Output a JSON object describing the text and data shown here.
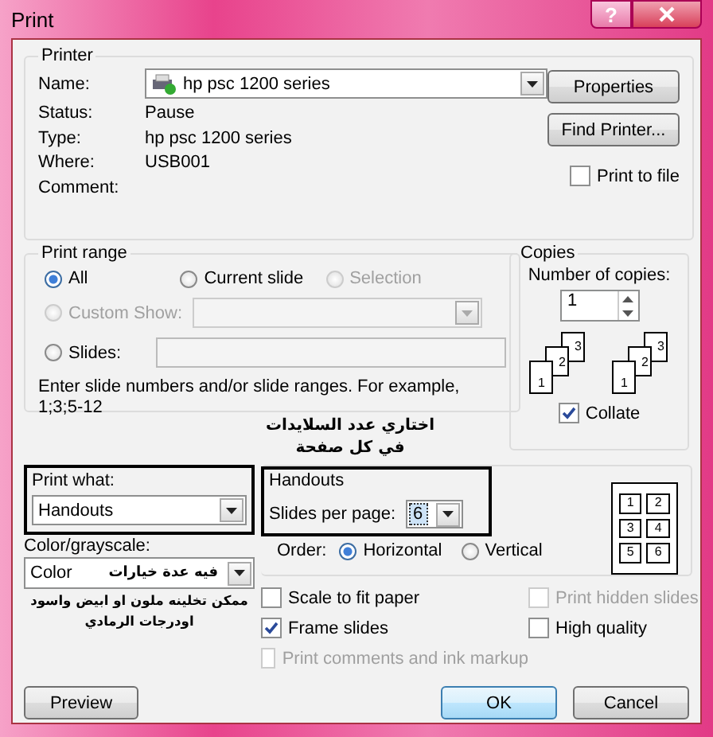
{
  "window": {
    "title": "Print",
    "help": "?"
  },
  "printer": {
    "legend": "Printer",
    "name_label": "Name:",
    "name_value": "hp psc 1200 series",
    "properties_button": "Properties",
    "find_button": "Find Printer...",
    "details": [
      {
        "label": "Status:",
        "value": "Pause"
      },
      {
        "label": "Type:",
        "value": "hp psc 1200 series"
      },
      {
        "label": "Where:",
        "value": "USB001"
      },
      {
        "label": "Comment:"
      }
    ],
    "print_to_file": {
      "label": "Print to file",
      "checked": false
    }
  },
  "print_range": {
    "legend": "Print range",
    "options": [
      {
        "label": "All",
        "selected": true,
        "disabled": false
      },
      {
        "label": "Current slide",
        "selected": false,
        "disabled": false
      },
      {
        "label": "Selection",
        "selected": false,
        "disabled": true
      }
    ],
    "custom_show": {
      "label": "Custom Show:",
      "selected": false,
      "disabled": true
    },
    "slides": {
      "label": "Slides:",
      "selected": false
    },
    "hint": "Enter slide numbers and/or slide ranges. For example, 1;3;5-12"
  },
  "copies": {
    "legend": "Copies",
    "label": "Number of copies:",
    "value": "1",
    "collate_pages": [
      [
        "1",
        "2",
        "3"
      ],
      [
        "1",
        "2",
        "3"
      ]
    ],
    "collate": {
      "label": "Collate",
      "checked": true
    }
  },
  "annotations": [
    {
      "lines": [
        "اختاري عدد السلايدات",
        "في كل صفحة"
      ]
    },
    {
      "lines": [
        "ممكن تخلينه ملون او ابيض واسود",
        "اودرجات الرمادي"
      ]
    }
  ],
  "print_what": {
    "label": "Print what:",
    "value": "Handouts",
    "highlighted": true
  },
  "color": {
    "label": "Color/grayscale:",
    "value": "Color",
    "annotation": "فيه عدة خيارات"
  },
  "handouts": {
    "legend": "Handouts",
    "highlighted": true,
    "slides_per_page_label": "Slides per page:",
    "slides_per_page": "6",
    "order_label": "Order:",
    "orders": [
      {
        "label": "Horizontal",
        "selected": true
      },
      {
        "label": "Vertical",
        "selected": false
      }
    ],
    "preview": [
      "1",
      "2",
      "3",
      "4",
      "5",
      "6"
    ]
  },
  "options": [
    {
      "label": "Scale to fit paper",
      "checked": false,
      "disabled": false
    },
    {
      "label": "Print hidden slides",
      "checked": false,
      "disabled": true
    },
    {
      "label": "Frame slides",
      "checked": true,
      "disabled": false
    },
    {
      "label": "High quality",
      "checked": false,
      "disabled": false
    },
    {
      "label": "Print comments and ink markup",
      "checked": false,
      "disabled": true
    }
  ],
  "buttons": {
    "preview": "Preview",
    "ok": "OK",
    "cancel": "Cancel"
  }
}
